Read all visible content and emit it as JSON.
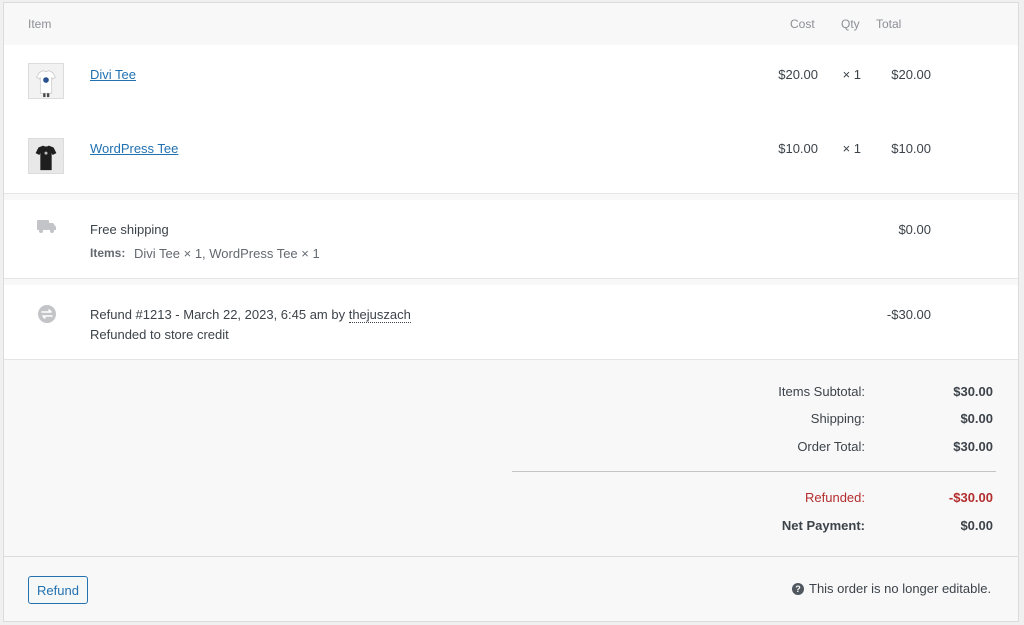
{
  "header": {
    "item": "Item",
    "cost": "Cost",
    "qty": "Qty",
    "total": "Total"
  },
  "items": [
    {
      "name": "Divi Tee",
      "cost": "$20.00",
      "qty": "× 1",
      "total": "$20.00"
    },
    {
      "name": "WordPress Tee",
      "cost": "$10.00",
      "qty": "× 1",
      "total": "$10.00"
    }
  ],
  "shipping": {
    "method": "Free shipping",
    "items_label": "Items:",
    "items_value": "Divi Tee × 1, WordPress Tee × 1",
    "total": "$0.00"
  },
  "refund_line": {
    "prefix": "Refund #1213 - March 22, 2023, 6:45 am by ",
    "user": "thejuszach",
    "note": "Refunded to store credit",
    "amount": "-$30.00"
  },
  "totals": {
    "subtotal_label": "Items Subtotal:",
    "subtotal_value": "$30.00",
    "shipping_label": "Shipping:",
    "shipping_value": "$0.00",
    "order_total_label": "Order Total:",
    "order_total_value": "$30.00",
    "refunded_label": "Refunded:",
    "refunded_value": "-$30.00",
    "net_label": "Net Payment:",
    "net_value": "$0.00"
  },
  "footer": {
    "refund_button": "Refund",
    "note": "This order is no longer editable."
  },
  "colors": {
    "link": "#2271b1",
    "refund_red": "#b32d2e",
    "panel_bg": "#f8f8f8"
  },
  "icons": [
    "truck-icon",
    "refund-arrows-icon",
    "help-icon"
  ]
}
